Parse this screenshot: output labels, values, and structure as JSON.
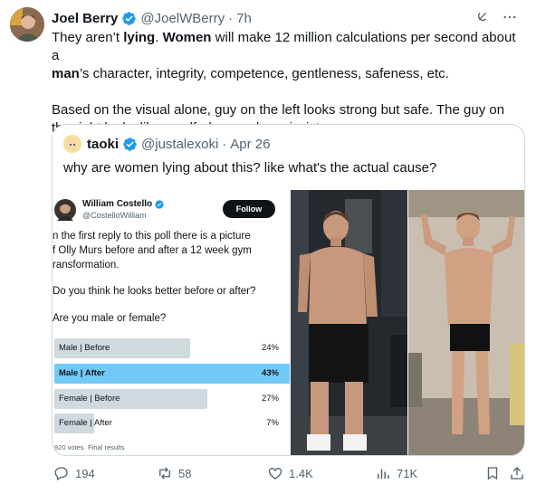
{
  "tweet": {
    "author_name": "Joel Berry",
    "handle": "@JoelWBerry",
    "time": "7h",
    "lines": [
      [
        "They aren’t ",
        "lying",
        ". ",
        "Women",
        " will make 12 million calculations per second about a"
      ],
      [
        "",
        "man",
        "’s character, integrity, competence, gentleness, safeness, etc."
      ]
    ],
    "paragraph2": "Based on the visual alone, guy on the left looks strong but safe. The guy on the right looks like a self-obsessed narcissist.",
    "bold_words": [
      "lying",
      "Women",
      "man"
    ]
  },
  "quote": {
    "author_name": "taoki",
    "handle": "@justalexoki",
    "date": "Apr 26",
    "text": "why are women lying about this? like what's the actual cause?"
  },
  "poll_card": {
    "name": "William Costello",
    "handle": "@CostelloWilliam",
    "follow_label": "Follow",
    "intro_lines": [
      "n the first reply to this poll there is a picture",
      "f Olly Murs before and after a 12 week gym",
      "ransformation."
    ],
    "question1": "Do you think he looks better before or after?",
    "question2": "Are you male or female?",
    "options": [
      {
        "label": "Male | Before",
        "pct": "24%",
        "value": 24
      },
      {
        "label": "Male | After",
        "pct": "43%",
        "value": 43,
        "winner": true
      },
      {
        "label": "Female | Before",
        "pct": "27%",
        "value": 27
      },
      {
        "label": "Female | After",
        "pct": "7%",
        "value": 7
      }
    ],
    "footer": "920 votes· Final results"
  },
  "actions": {
    "replies": "194",
    "retweets": "58",
    "likes": "1.4K",
    "views": "71K"
  },
  "icons": [
    "verified-badge-icon",
    "grok-icon",
    "more-icon",
    "reply-icon",
    "retweet-icon",
    "like-icon",
    "views-icon",
    "bookmark-icon",
    "share-icon"
  ],
  "colors": {
    "verified": "#1d9bf0",
    "winner_bar": "#71c9f8",
    "bar": "#cfd9de",
    "muted": "#536471"
  }
}
